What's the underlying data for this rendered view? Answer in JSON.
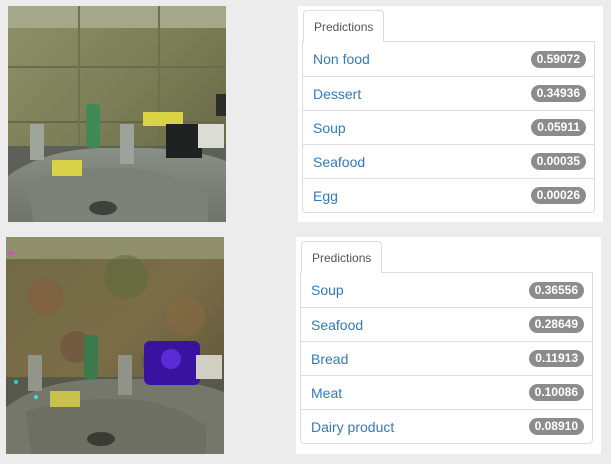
{
  "panels": [
    {
      "tab_label": "Predictions",
      "predictions": [
        {
          "label": "Non food",
          "score": "0.59072"
        },
        {
          "label": "Dessert",
          "score": "0.34936"
        },
        {
          "label": "Soup",
          "score": "0.05911"
        },
        {
          "label": "Seafood",
          "score": "0.00035"
        },
        {
          "label": "Egg",
          "score": "0.00026"
        }
      ]
    },
    {
      "tab_label": "Predictions",
      "predictions": [
        {
          "label": "Soup",
          "score": "0.36556"
        },
        {
          "label": "Seafood",
          "score": "0.28649"
        },
        {
          "label": "Bread",
          "score": "0.11913"
        },
        {
          "label": "Meat",
          "score": "0.10086"
        },
        {
          "label": "Dairy product",
          "score": "0.08910"
        }
      ]
    }
  ],
  "colors": {
    "link": "#337ab7",
    "badge": "#8c8c8c",
    "page_background": "#ececec"
  }
}
